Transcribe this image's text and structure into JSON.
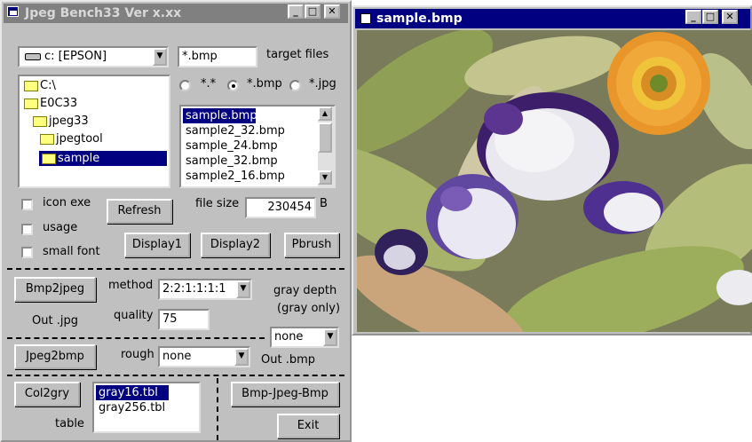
{
  "bench": {
    "title": "Jpeg Bench33 Ver x.xx",
    "drive": {
      "value": "c: [EPSON]"
    },
    "folders": [
      "C:\\",
      "E0C33",
      "jpeg33",
      "jpegtool",
      "sample"
    ],
    "filter": {
      "value": "*.bmp",
      "label": "target files"
    },
    "radios": [
      "*.*",
      "*.bmp",
      "*.jpg"
    ],
    "files": [
      "sample.bmp",
      "sample2_32.bmp",
      "sample_24.bmp",
      "sample_32.bmp",
      "sample2_16.bmp"
    ],
    "checks": {
      "icon_exe": "icon exe",
      "usage": "usage",
      "small_font": "small font"
    },
    "refresh": "Refresh",
    "file_size": {
      "label": "file size",
      "value": "230454",
      "unit": "B"
    },
    "display1": "Display1",
    "display2": "Display2",
    "pbrush": "Pbrush",
    "bmp2jpeg": "Bmp2jpeg",
    "method": {
      "label": "method",
      "value": "2:2:1:1:1:1"
    },
    "gray_depth": {
      "line1": "gray depth",
      "line2": "(gray only)",
      "value": "none"
    },
    "out_jpg": "Out .jpg",
    "quality": {
      "label": "quality",
      "value": "75"
    },
    "jpeg2bmp": "Jpeg2bmp",
    "rough": {
      "label": "rough",
      "value": "none"
    },
    "out_bmp": "Out .bmp",
    "col2gry": "Col2gry",
    "tables": [
      "gray16.tbl",
      "gray256.tbl"
    ],
    "table_label": "table",
    "bmp_jpeg_bmp": "Bmp-Jpeg-Bmp",
    "exit": "Exit"
  },
  "viewer": {
    "title": "sample.bmp"
  },
  "colors": {
    "active_title": "#000080",
    "inactive_title": "#808080",
    "face": "#c0c0c0"
  }
}
